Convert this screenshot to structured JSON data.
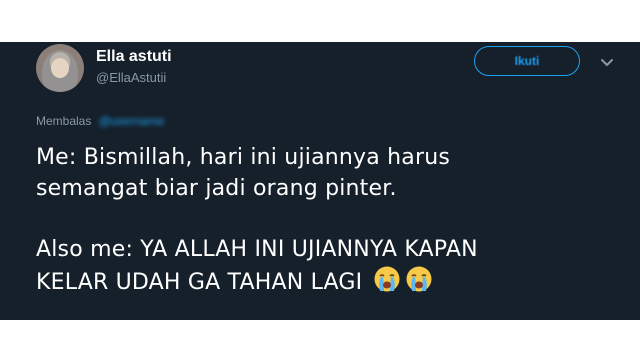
{
  "tweet": {
    "display_name": "Ella astuti",
    "handle": "@EllaAstutii",
    "follow_label": "Ikuti",
    "reply_prefix": "Membalas",
    "reply_to": "@username",
    "line1": "Me: Bismillah, hari ini ujiannya harus",
    "line2": "semangat biar jadi orang pinter.",
    "line3": "Also me: YA ALLAH INI UJIANNYA KAPAN",
    "line4": "KELAR UDAH GA TAHAN LAGI",
    "emoji": [
      "crying-face-emoji",
      "crying-face-emoji"
    ]
  },
  "colors": {
    "background": "#15202b",
    "accent": "#1da1f2",
    "secondary_text": "#8899a6",
    "primary_text": "#ffffff"
  }
}
